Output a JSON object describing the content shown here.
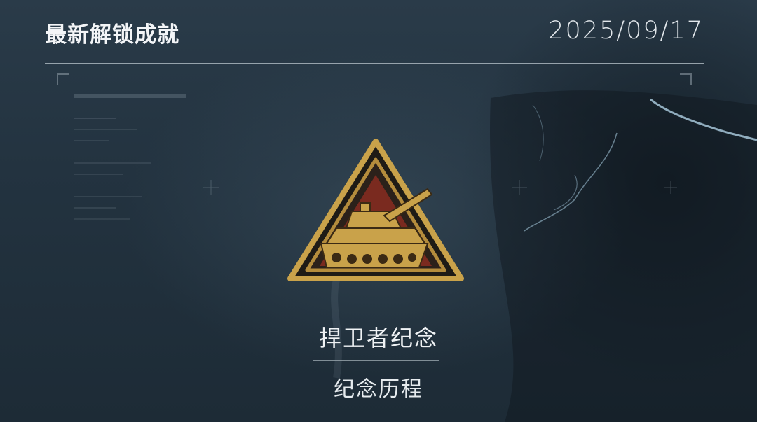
{
  "header": {
    "title": "最新解锁成就",
    "date": "2025/09/17"
  },
  "achievement": {
    "name": "捍卫者纪念",
    "category": "纪念历程",
    "icon": "tank-triangle-badge-icon"
  },
  "colors": {
    "background": "#223240",
    "badge_gold": "#c9a24a",
    "badge_red": "#7a2a1f",
    "text": "#f0f3f5"
  }
}
